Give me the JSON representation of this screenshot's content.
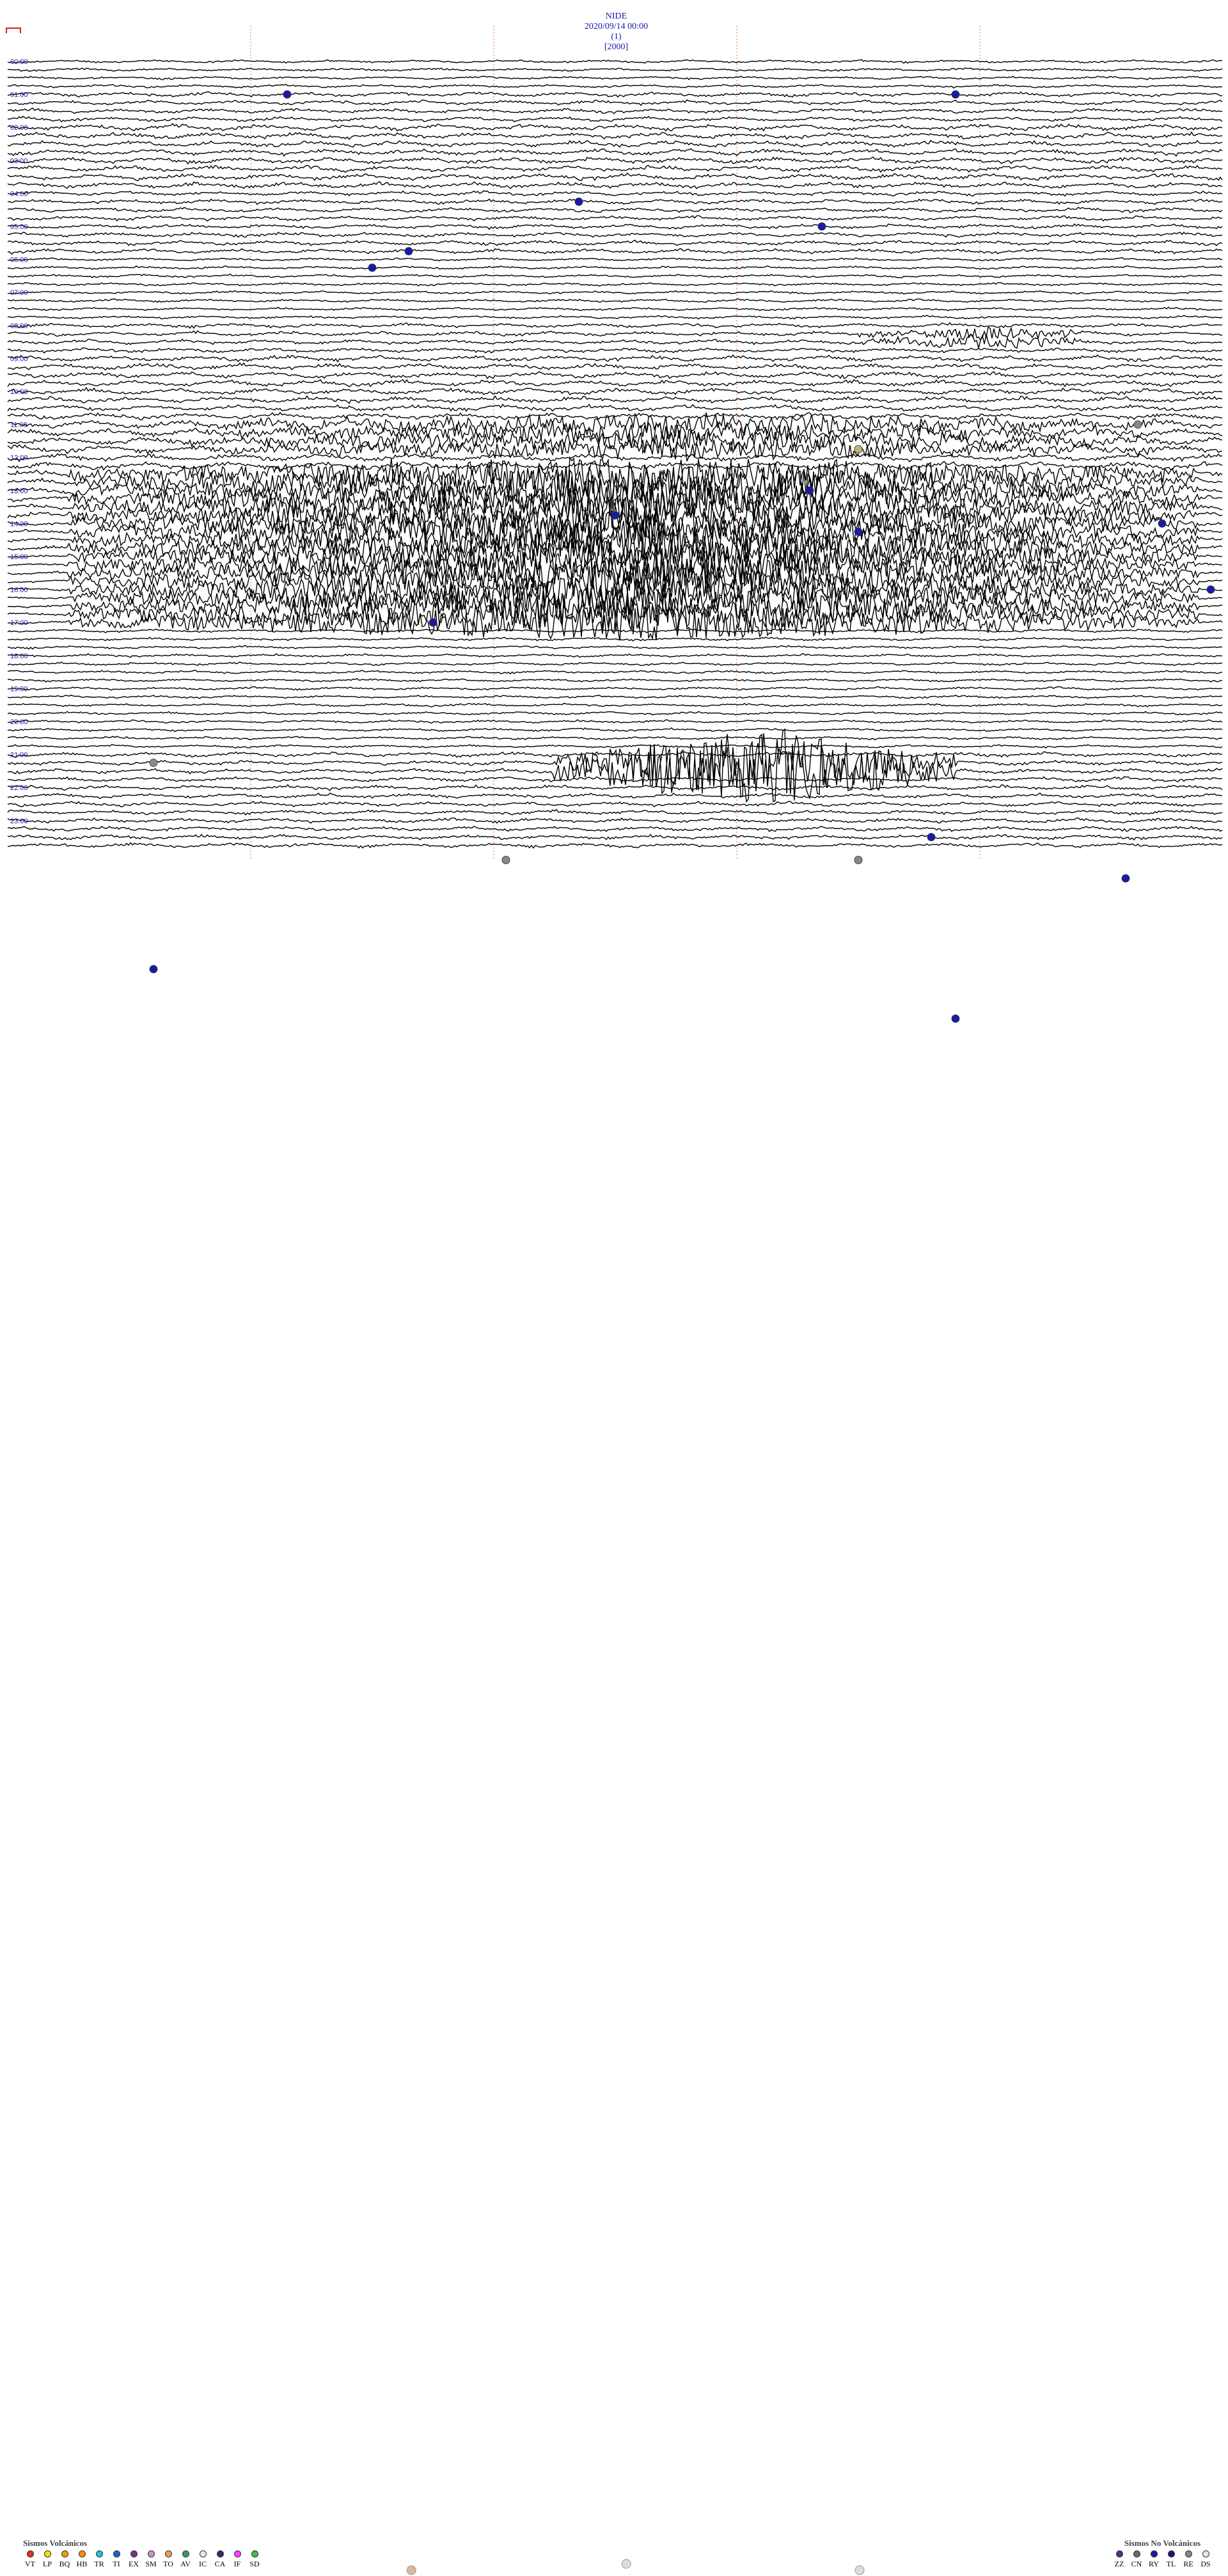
{
  "header": {
    "station": "NIDE",
    "datetime": "2020/09/14 00:00",
    "channel": "(1)",
    "scale": "[2000]"
  },
  "chart_data": {
    "type": "line",
    "title": "NIDE 2020/09/14 00:00 (1) [2000]",
    "description_kind": "helicorder seismogram (24 hours, 4 traces per hour)",
    "hours": [
      "00:00",
      "01:00",
      "02:00",
      "03:00",
      "04:00",
      "05:00",
      "06:00",
      "07:00",
      "08:00",
      "09:00",
      "10:00",
      "11:00",
      "12:00",
      "13:00",
      "14:00",
      "15:00",
      "16:00",
      "17:00",
      "18:00",
      "19:00",
      "20:00",
      "21:00",
      "22:00",
      "23:00"
    ],
    "rows_per_hour": 4,
    "noise_level_by_hour": [
      2,
      3,
      4,
      4,
      3,
      3,
      2,
      2,
      3,
      4,
      4,
      5,
      5,
      4,
      3,
      2,
      2,
      2,
      2,
      2,
      2,
      3,
      3,
      3
    ],
    "events": [
      {
        "row": 4,
        "pos": 0.23,
        "class": "blue"
      },
      {
        "row": 4,
        "pos": 0.78,
        "class": "blue"
      },
      {
        "row": 17,
        "pos": 0.47,
        "class": "blue"
      },
      {
        "row": 20,
        "pos": 0.67,
        "class": "blue"
      },
      {
        "row": 23,
        "pos": 0.33,
        "class": "blue"
      },
      {
        "row": 25,
        "pos": 0.3,
        "class": "blue"
      },
      {
        "row": 44,
        "pos": 0.93,
        "class": "gray"
      },
      {
        "row": 47,
        "pos": 0.7,
        "class": "tan"
      },
      {
        "row": 52,
        "pos": 0.66,
        "class": "blue"
      },
      {
        "row": 55,
        "pos": 0.5,
        "class": "blue"
      },
      {
        "row": 56,
        "pos": 0.95,
        "class": "blue"
      },
      {
        "row": 57,
        "pos": 0.7,
        "class": "blue"
      },
      {
        "row": 64,
        "pos": 0.99,
        "class": "blue"
      },
      {
        "row": 68,
        "pos": 0.35,
        "class": "blue"
      },
      {
        "row": 85,
        "pos": 0.12,
        "class": "gray"
      },
      {
        "row": 94,
        "pos": 0.76,
        "class": "blue"
      },
      {
        "row": 99,
        "pos": 0.92,
        "class": "blue"
      },
      {
        "row": 110,
        "pos": 0.12,
        "class": "blue"
      },
      {
        "row": 116,
        "pos": 0.78,
        "class": "blue"
      }
    ],
    "bursts": [
      {
        "row_start": 33,
        "row_end": 34,
        "pos_start": 0.7,
        "pos_end": 0.9,
        "amp": 8
      },
      {
        "row_start": 44,
        "row_end": 47,
        "pos_start": 0.15,
        "pos_end": 0.95,
        "amp": 12
      },
      {
        "row_start": 50,
        "row_end": 68,
        "pos_start": 0.05,
        "pos_end": 0.98,
        "amp": 22
      },
      {
        "row_start": 85,
        "row_end": 86,
        "pos_start": 0.45,
        "pos_end": 0.78,
        "amp": 44
      },
      {
        "row_start": 99,
        "row_end": 99,
        "pos_start": 0.93,
        "pos_end": 1.0,
        "amp": 12
      }
    ],
    "bottom_markers": [
      {
        "pos": 0.41,
        "color": "#888888"
      },
      {
        "pos": 0.7,
        "color": "#888888"
      }
    ],
    "footer_markers": [
      {
        "pos": 0.335,
        "color": "#d9b8a0"
      },
      {
        "pos": 0.51,
        "color": "#dddddd"
      },
      {
        "pos": 0.7,
        "color": "#dddddd"
      }
    ]
  },
  "legend_volcanic": {
    "title": "Sismos Volcánicos",
    "items": [
      {
        "code": "VT",
        "color": "#e0301e"
      },
      {
        "code": "LP",
        "color": "#f2e600"
      },
      {
        "code": "BQ",
        "color": "#f0a000"
      },
      {
        "code": "HB",
        "color": "#ff8a00"
      },
      {
        "code": "TR",
        "color": "#22c0e0"
      },
      {
        "code": "TI",
        "color": "#2060d0"
      },
      {
        "code": "EX",
        "color": "#7b2d8e"
      },
      {
        "code": "SM",
        "color": "#c994c7"
      },
      {
        "code": "TO",
        "color": "#e8a060"
      },
      {
        "code": "AV",
        "color": "#3a9a5a"
      },
      {
        "code": "IC",
        "color": "#e8e8e8"
      },
      {
        "code": "CA",
        "color": "#3a2a6a"
      },
      {
        "code": "IF",
        "color": "#ff40ff"
      },
      {
        "code": "SD",
        "color": "#40c040"
      }
    ]
  },
  "legend_nonvolcanic": {
    "title": "Sismos No Volcánicos",
    "items": [
      {
        "code": "ZZ",
        "color": "#5a2a8a"
      },
      {
        "code": "CN",
        "color": "#6a6a6a"
      },
      {
        "code": "RY",
        "color": "#1a1aa8"
      },
      {
        "code": "TL",
        "color": "#1a1a6a"
      },
      {
        "code": "RE",
        "color": "#888888"
      },
      {
        "code": "DS",
        "color": "#e8e8e8"
      }
    ]
  }
}
